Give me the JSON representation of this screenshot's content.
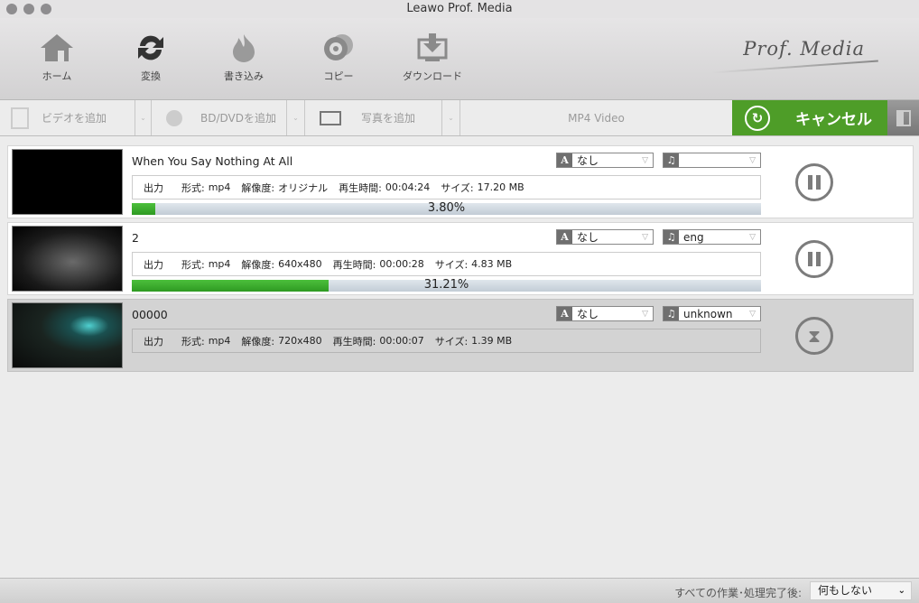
{
  "window": {
    "title": "Leawo Prof. Media"
  },
  "nav": [
    {
      "label": "ホーム"
    },
    {
      "label": "変換"
    },
    {
      "label": "書き込み"
    },
    {
      "label": "コピー"
    },
    {
      "label": "ダウンロード"
    }
  ],
  "brand": "Prof. Media",
  "subtoolbar": {
    "add_video": "ビデオを追加",
    "add_disc": "BD/DVDを追加",
    "add_photo": "写真を追加",
    "profile": "MP4 Video",
    "cancel": "キャンセル"
  },
  "info_labels": {
    "output": "出力",
    "format": "形式:",
    "resolution": "解像度:",
    "duration": "再生時間:",
    "size": "サイズ:"
  },
  "items": [
    {
      "name": "When You Say Nothing At All",
      "subtitle": "なし",
      "audio": "",
      "format": "mp4",
      "resolution": "オリジナル",
      "duration": "00:04:24",
      "size": "17.20 MB",
      "progress": 3.8,
      "progress_label": "3.80%",
      "state": "converting"
    },
    {
      "name": "2",
      "subtitle": "なし",
      "audio": "eng",
      "format": "mp4",
      "resolution": "640x480",
      "duration": "00:00:28",
      "size": "4.83 MB",
      "progress": 31.21,
      "progress_label": "31.21%",
      "state": "converting"
    },
    {
      "name": "00000",
      "subtitle": "なし",
      "audio": "unknown",
      "format": "mp4",
      "resolution": "720x480",
      "duration": "00:00:07",
      "size": "1.39 MB",
      "state": "waiting"
    }
  ],
  "footer": {
    "label": "すべての作業･処理完了後:",
    "value": "何もしない"
  },
  "colors": {
    "accent": "#4e9d28",
    "progress": "#3aad2e"
  }
}
